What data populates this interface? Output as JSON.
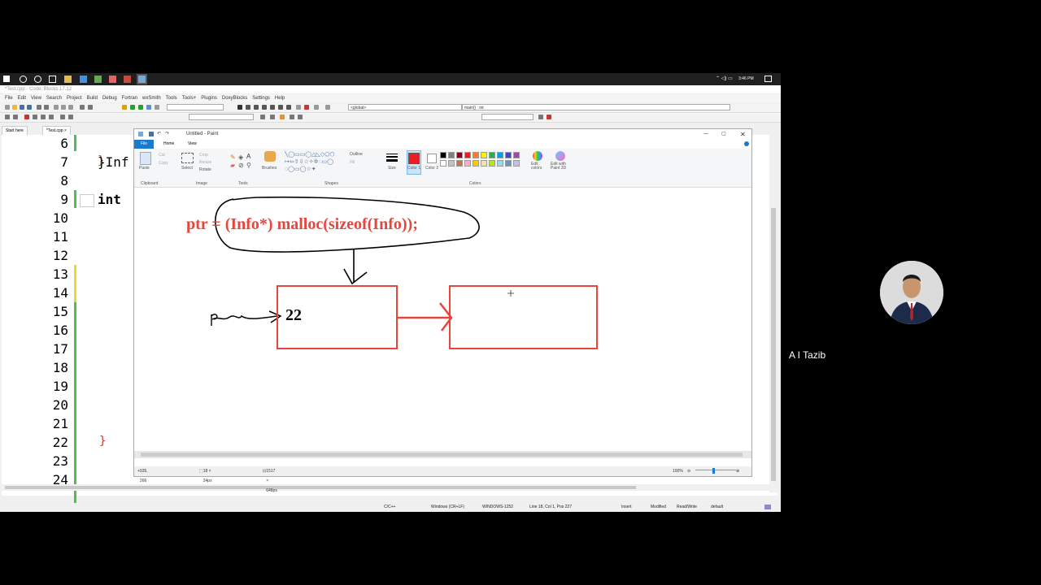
{
  "taskbar": {
    "time": "3:46 PM"
  },
  "codeblocks": {
    "title": "*Test.cpp - Code::Blocks 17.12",
    "menu": [
      "File",
      "Edit",
      "View",
      "Search",
      "Project",
      "Build",
      "Debug",
      "Fortran",
      "wxSmith",
      "Tools",
      "Tools+",
      "Plugins",
      "DoxyBlocks",
      "Settings",
      "Help"
    ],
    "scope_combo": "<global>",
    "symbol_combo": "main() : int",
    "tabs": [
      "Start here",
      "*Test.cpp"
    ],
    "line_numbers": [
      "6",
      "7",
      "8",
      "9",
      "10",
      "11",
      "12",
      "13",
      "14",
      "15",
      "16",
      "17",
      "18",
      "19",
      "20",
      "21",
      "22",
      "23",
      "24"
    ],
    "code": {
      "line7": "}Inf",
      "line9": "int",
      "line22": "}"
    },
    "status": {
      "lang": "C/C++",
      "eol": "Windows (CR+LF)",
      "encoding": "WINDOWS-1252",
      "position": "Line 18, Col 1, Pos 227",
      "mode": "Insert",
      "modified": "Modified",
      "access": "Read/Write",
      "profile": "default"
    }
  },
  "paint": {
    "title": "Untitled - Paint",
    "tabs": [
      "File",
      "Home",
      "View"
    ],
    "ribbon": {
      "paste": "Paste",
      "cut": "Cut",
      "copy": "Copy",
      "select": "Select",
      "crop": "Crop",
      "resize": "Resize",
      "rotate": "Rotate",
      "brushes": "Brushes",
      "outline": "Outline",
      "fill": "Fill",
      "size": "Size",
      "color1": "Color 1",
      "color2": "Color 2",
      "edit_colors": "Edit colors",
      "edit_paint3d": "Edit with Paint 3D",
      "groups": [
        "Clipboard",
        "Image",
        "Tools",
        "Shapes",
        "Colors"
      ]
    },
    "palette": [
      "#000000",
      "#7f7f7f",
      "#880015",
      "#ed1c24",
      "#ff7f27",
      "#fff200",
      "#22b14c",
      "#00a2e8",
      "#3f48cc",
      "#a349a4",
      "#ffffff",
      "#c3c3c3",
      "#b97a57",
      "#ffaec9",
      "#ffc90e",
      "#efe4b0",
      "#b5e61d",
      "#99d9ea",
      "#7092be",
      "#c8bfe7"
    ],
    "drawing": {
      "code_text": "ptr = (Info*) malloc(sizeof(Info));",
      "node_value": "22",
      "ptr_label": "ptr",
      "accent": "#e8453c"
    },
    "status": {
      "cursor": "935, 266",
      "selection": "18 × 24px",
      "canvas": "1517 × 648px",
      "zoom": "100%"
    }
  },
  "participant": {
    "name": "A I Tazib"
  }
}
